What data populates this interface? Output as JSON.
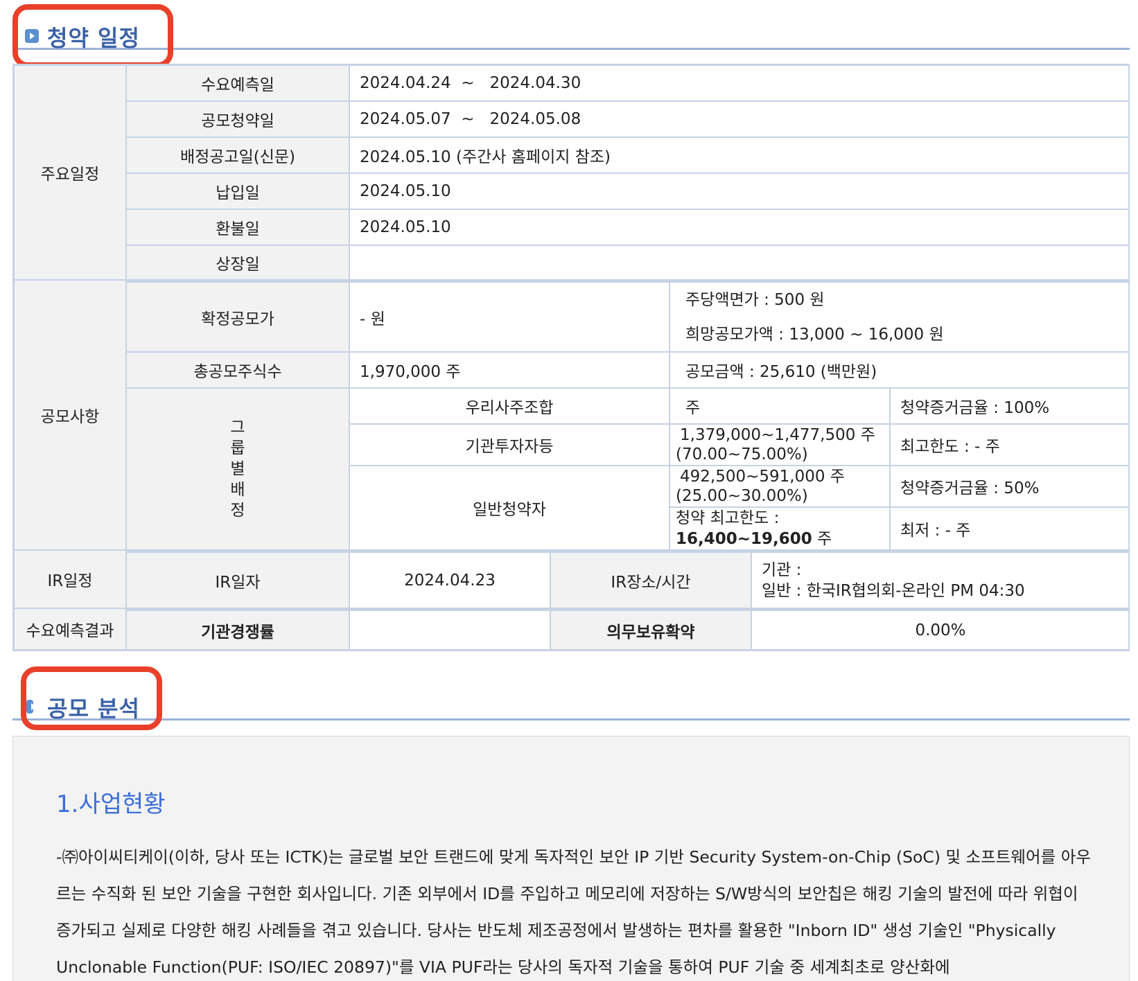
{
  "schedule_section": {
    "title": "청약 일정"
  },
  "main_schedule": {
    "group_label": "주요일정",
    "rows": [
      {
        "label": "수요예측일",
        "value": "2024.04.24  ~   2024.04.30"
      },
      {
        "label": "공모청약일",
        "value": "2024.05.07  ~   2024.05.08"
      },
      {
        "label": "배정공고일(신문)",
        "value": "2024.05.10 (주간사 홈페이지 참조)"
      },
      {
        "label": "납입일",
        "value": "2024.05.10"
      },
      {
        "label": "환불일",
        "value": "2024.05.10"
      },
      {
        "label": "상장일",
        "value": ""
      }
    ]
  },
  "offering": {
    "group_label": "공모사항",
    "final_price_label": "확정공모가",
    "final_price_value": "- 원",
    "par_value": "주당액면가 :  500 원",
    "desired_price": "희망공모가액 :  13,000 ~ 16,000 원",
    "total_shares_label": "총공모주식수",
    "total_shares_value": "1,970,000 주",
    "offer_amount": "공모금액 : 25,610 (백만원)",
    "allocation_label": [
      "그",
      "룹",
      "별",
      "배",
      "정"
    ],
    "allocation": {
      "employee_label": "우리사주조합",
      "employee_shares": "주",
      "employee_deposit": "청약증거금율 : 100%",
      "institution_label": "기관투자자등",
      "institution_shares": "1,379,000~1,477,500 주",
      "institution_pct": "(70.00~75.00%)",
      "institution_limit": "최고한도 :  - 주",
      "retail_label": "일반청약자",
      "retail_shares": "492,500~591,000 주",
      "retail_pct": "(25.00~30.00%)",
      "retail_deposit": "청약증거금율 : 50%",
      "retail_max_label": "청약 최고한도 :",
      "retail_max_value": "16,400~19,600",
      "retail_max_unit": " 주",
      "retail_min": "최저 :  - 주"
    }
  },
  "ir": {
    "group_label": "IR일정",
    "date_label": "IR일자",
    "date_value": "2024.04.23",
    "place_label": "IR장소/시간",
    "place_institution": "기관 :",
    "place_general": "일반 : 한국IR협의회-온라인 PM 04:30"
  },
  "demand_result": {
    "group_label": "수요예측결과",
    "competition_label": "기관경쟁률",
    "competition_value": "",
    "lockup_label": "의무보유확약",
    "lockup_value": "0.00%"
  },
  "analysis_section": {
    "title": "공모 분석",
    "heading": "1.사업현황",
    "body": "-㈜아이씨티케이(이하, 당사 또는 ICTK)는 글로벌 보안 트랜드에 맞게 독자적인 보안 IP 기반 Security System-on-Chip (SoC) 및 소프트웨어를 아우르는 수직화 된 보안 기술을 구현한 회사입니다. 기존 외부에서 ID를 주입하고 메모리에 저장하는 S/W방식의 보안칩은 해킹 기술의 발전에 따라  위협이 증가되고 실제로 다양한 해킹 사례들을 겪고 있습니다. 당사는 반도체 제조공정에서 발생하는 편차를 활용한 \"Inborn ID\" 생성 기술인 \"Physically Unclonable Function(PUF:  ISO/IEC 20897)\"를 VIA PUF라는 당사의 독자적 기술을 통하여 PUF 기술 중 세계최초로 양산화에"
  }
}
